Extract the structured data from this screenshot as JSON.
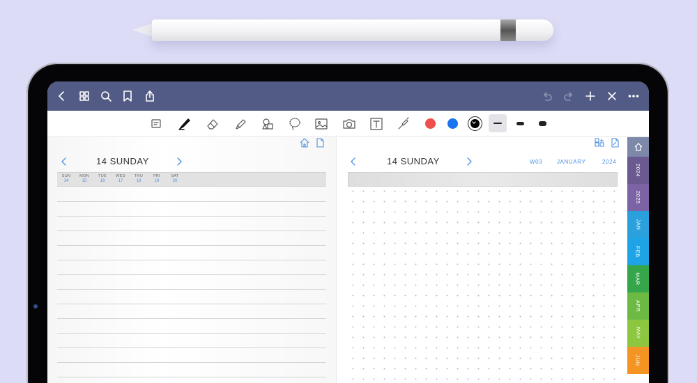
{
  "left_page": {
    "title": "14 SUNDAY",
    "week_days": [
      {
        "name": "SUN",
        "num": "14"
      },
      {
        "name": "MON",
        "num": "15"
      },
      {
        "name": "TUE",
        "num": "16"
      },
      {
        "name": "WED",
        "num": "17"
      },
      {
        "name": "THU",
        "num": "18"
      },
      {
        "name": "FRI",
        "num": "19"
      },
      {
        "name": "SAT",
        "num": "20"
      }
    ]
  },
  "right_page": {
    "title": "14 SUNDAY",
    "week": "W03",
    "month": "JANUARY",
    "year": "2024"
  },
  "colors": {
    "nav_bar": "#515b85",
    "accent": "#4a90e2",
    "swatch_red": "#ef4f4a",
    "swatch_blue": "#1a73f0",
    "swatch_black": "#000000"
  },
  "tabs": [
    {
      "icon": "home-icon",
      "color": "#7e89a9"
    },
    {
      "label": "2024",
      "color": "#6a5a8f"
    },
    {
      "label": "2025",
      "color": "#7c63a6"
    },
    {
      "label": "JAN",
      "color": "#2aa0dc"
    },
    {
      "label": "FEB",
      "color": "#1ea3e6"
    },
    {
      "label": "MAR",
      "color": "#36a64a"
    },
    {
      "label": "APR",
      "color": "#6cb943"
    },
    {
      "label": "MAY",
      "color": "#8dc63f"
    },
    {
      "label": "JUN",
      "color": "#f39423"
    }
  ]
}
